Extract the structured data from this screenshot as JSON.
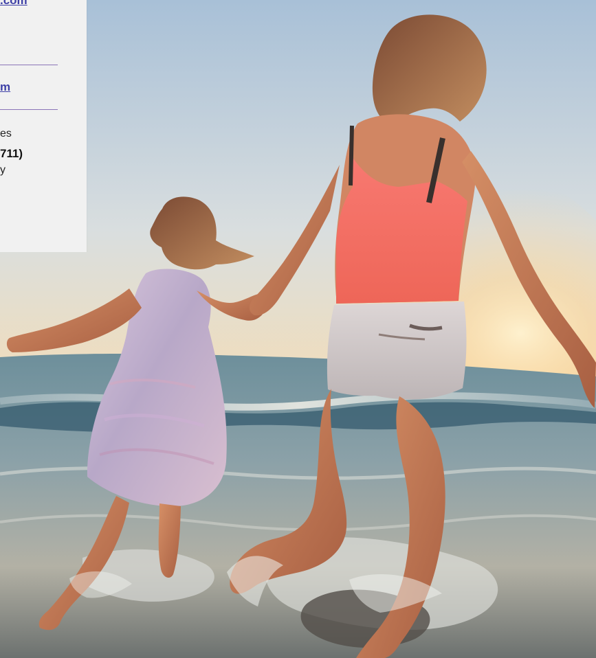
{
  "info_card": {
    "email_link": ".com",
    "website_link": "m",
    "line_1": "es",
    "phone": " 711)",
    "line_3": "y"
  },
  "photo": {
    "scene": "mother-and-daughter-walking-into-ocean-at-sunset"
  }
}
